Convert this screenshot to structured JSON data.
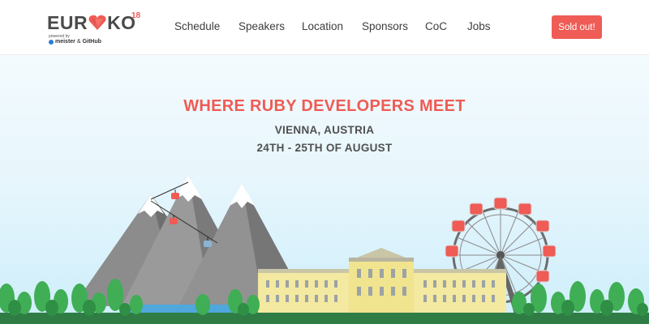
{
  "header": {
    "logo": {
      "text_left": "EUR",
      "text_right": "KO",
      "superscript": "18",
      "powered_by": "powered by",
      "sponsor_1": "meister",
      "separator": "&",
      "sponsor_2": "GitHub",
      "heart_icon": "ruby-heart-icon",
      "heart_color": "#ef5b55"
    },
    "nav": [
      {
        "label": "Schedule"
      },
      {
        "label": "Speakers"
      },
      {
        "label": "Location"
      },
      {
        "label": "Sponsors"
      },
      {
        "label": "CoC"
      },
      {
        "label": "Jobs"
      }
    ],
    "cta": {
      "label": "Sold out!",
      "color": "#ef5b55"
    }
  },
  "hero": {
    "tagline": "WHERE RUBY DEVELOPERS MEET",
    "city": "VIENNA, AUSTRIA",
    "dates": "24TH - 25TH OF AUGUST",
    "accent_color": "#ef5b55",
    "illustration": {
      "mountains": "snowy-mountains",
      "cable_car": "red-gondolas",
      "ferris_wheel": "giant-ferris-wheel-red-cabins",
      "palace": "yellow-palace",
      "trees": "green-trees",
      "river": "blue-river"
    }
  }
}
